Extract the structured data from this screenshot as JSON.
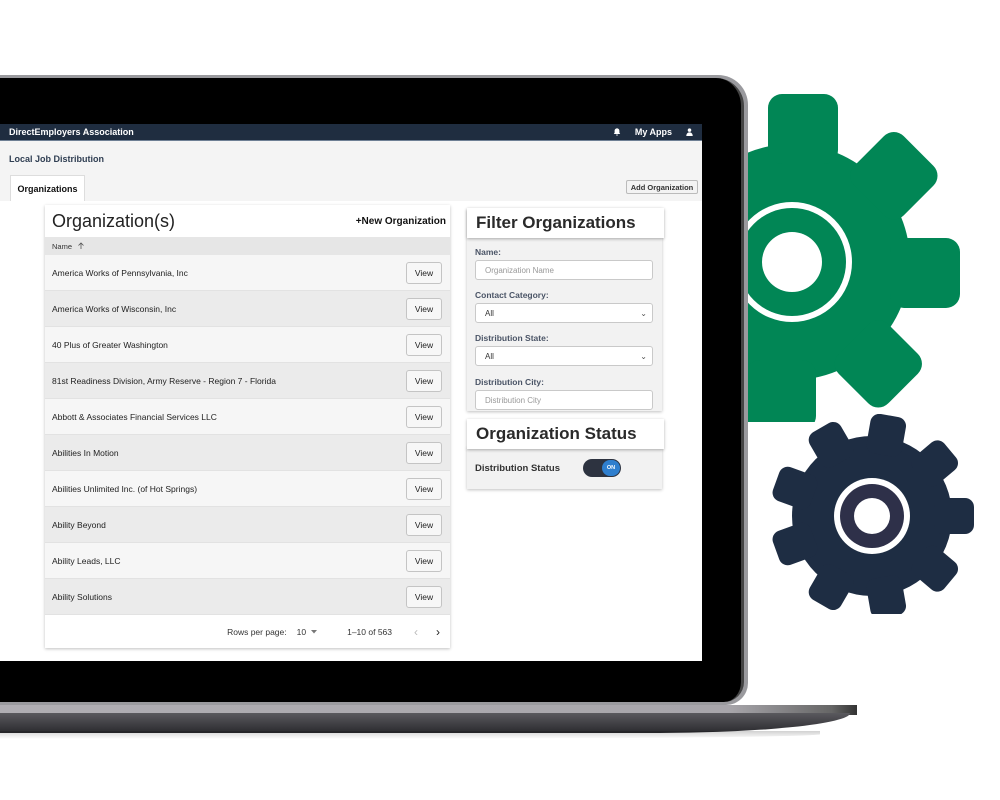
{
  "app": {
    "brand": "DirectEmployers Association",
    "my_apps": "My Apps",
    "subtitle": "Local Job Distribution",
    "active_tab": "Organizations",
    "add_organization": "Add Organization"
  },
  "table": {
    "title": "Organization(s)",
    "new_organization": "+New Organization",
    "column_name": "Name",
    "sort_direction": "ascending",
    "view_label": "View",
    "rows": [
      {
        "name": "America Works of Pennsylvania, Inc"
      },
      {
        "name": "America Works of Wisconsin, Inc"
      },
      {
        "name": "40 Plus of Greater Washington"
      },
      {
        "name": "81st Readiness Division, Army Reserve - Region 7 - Florida"
      },
      {
        "name": "Abbott & Associates Financial Services LLC"
      },
      {
        "name": "Abilities In Motion"
      },
      {
        "name": "Abilities Unlimited Inc. (of Hot Springs)"
      },
      {
        "name": "Ability Beyond"
      },
      {
        "name": "Ability Leads, LLC"
      },
      {
        "name": "Ability Solutions"
      }
    ],
    "pager": {
      "rows_per_page_label": "Rows per page:",
      "rows_per_page_value": "10",
      "range": "1–10 of 563",
      "prev": "‹",
      "next": "›"
    }
  },
  "filters": {
    "title": "Filter Organizations",
    "name_label": "Name:",
    "name_placeholder": "Organization Name",
    "contact_category_label": "Contact Category:",
    "contact_category_value": "All",
    "distribution_state_label": "Distribution State:",
    "distribution_state_value": "All",
    "distribution_city_label": "Distribution City:",
    "distribution_city_placeholder": "Distribution City"
  },
  "status": {
    "title": "Organization Status",
    "distribution_status_label": "Distribution Status",
    "toggle_label": "ON",
    "toggle_on": true
  },
  "colors": {
    "navbar": "#1f2d40",
    "gear_green": "#018655",
    "gear_navy": "#1e2d43",
    "toggle_accent": "#2f7fce"
  }
}
